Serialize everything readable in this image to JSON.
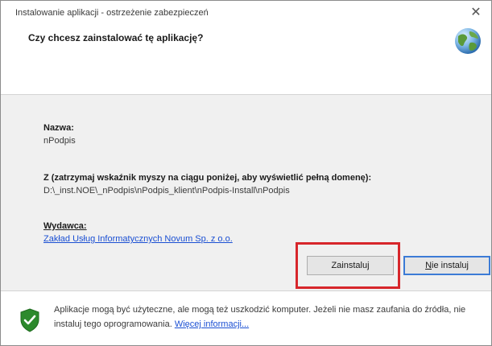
{
  "window": {
    "title": "Instalowanie aplikacji - ostrzeżenie zabezpieczeń",
    "close_glyph": "✕"
  },
  "header": {
    "question": "Czy chcesz zainstalować tę aplikację?",
    "icon": "globe-icon"
  },
  "details": {
    "name_label": "Nazwa:",
    "name_value": "nPodpis",
    "from_label": "Z (zatrzymaj wskaźnik myszy na ciągu poniżej, aby wyświetlić pełną domenę):",
    "from_value": "D:\\_inst.NOE\\_nPodpis\\nPodpis_klient\\nPodpis-Install\\nPodpis",
    "publisher_label": "Wydawca:",
    "publisher_value": "Zakład Usług Informatycznych Novum Sp. z o.o."
  },
  "buttons": {
    "install_label": "Zainstaluj",
    "cancel_prefix": "",
    "cancel_underlined": "N",
    "cancel_suffix": "ie instaluj"
  },
  "footer": {
    "warning_text": "Aplikacje mogą być użyteczne, ale mogą też uszkodzić komputer. Jeżeli nie masz zaufania do źródła, nie instaluj tego oprogramowania.",
    "more_info_link": "Więcej informacji...",
    "icon": "shield-icon"
  },
  "colors": {
    "highlight": "#d7262b",
    "link": "#1a4fd3",
    "default_button_border": "#3c7bd6",
    "dialog_background": "#f0f0f0"
  }
}
